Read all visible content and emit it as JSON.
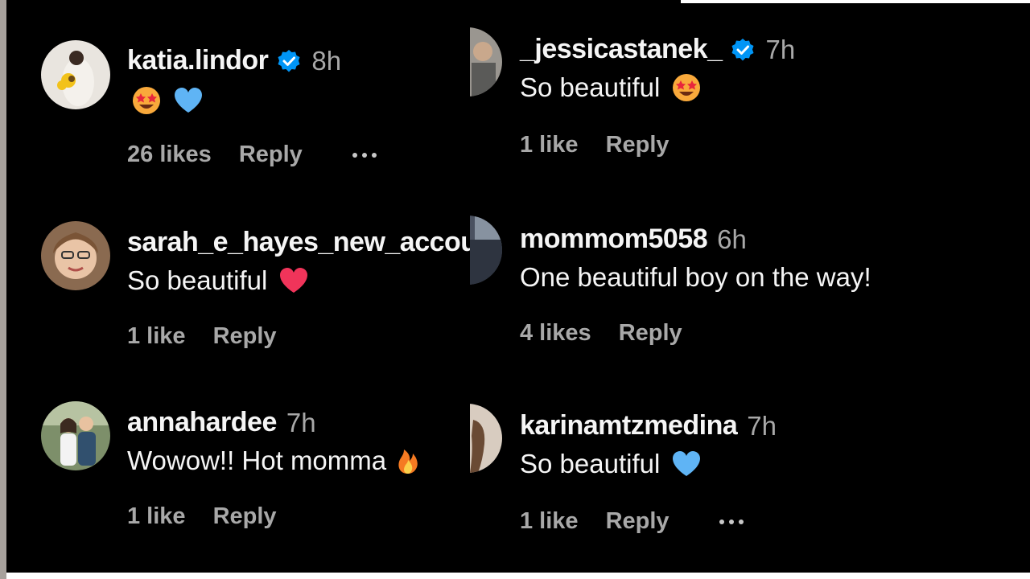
{
  "left_column": [
    {
      "username": "katia.lindor",
      "verified": true,
      "time": "8h",
      "text": "",
      "emojis": [
        "star-struck-emoji",
        "blue-heart-emoji"
      ],
      "likes": "26 likes",
      "reply": "Reply",
      "has_more": true
    },
    {
      "username": "sarah_e_hayes_new_accou",
      "verified": false,
      "time": "",
      "text": "So beautiful",
      "emojis": [
        "red-heart-emoji"
      ],
      "likes": "1 like",
      "reply": "Reply",
      "has_more": false
    },
    {
      "username": "annahardee",
      "verified": false,
      "time": "7h",
      "text": "Wowow!! Hot momma",
      "emojis": [
        "fire-emoji"
      ],
      "likes": "1 like",
      "reply": "Reply",
      "has_more": false
    }
  ],
  "right_column": [
    {
      "username": "_jessicastanek_",
      "verified": true,
      "time": "7h",
      "text": "So beautiful",
      "emojis": [
        "star-struck-emoji"
      ],
      "likes": "1 like",
      "reply": "Reply",
      "has_more": false
    },
    {
      "username": "mommom5058",
      "verified": false,
      "time": "6h",
      "text": "One beautiful boy on the way!",
      "emojis": [],
      "likes": "4 likes",
      "reply": "Reply",
      "has_more": false
    },
    {
      "username": "karinamtzmedina",
      "verified": false,
      "time": "7h",
      "text": "So beautiful",
      "emojis": [
        "blue-heart-emoji"
      ],
      "likes": "1 like",
      "reply": "Reply",
      "has_more": true
    }
  ],
  "colors": {
    "background": "#000000",
    "username": "#f5f5f5",
    "secondary": "#a8a8a8",
    "verified_badge": "#0095f6"
  }
}
